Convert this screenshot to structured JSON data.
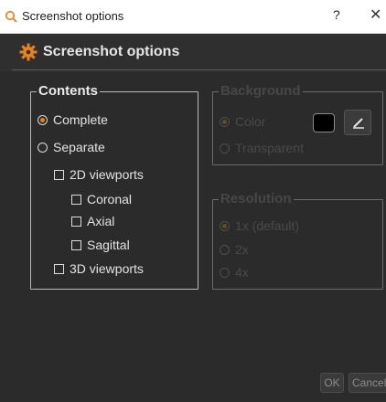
{
  "window": {
    "title": "Screenshot options",
    "help": "?",
    "close": "✕"
  },
  "header": {
    "title": "Screenshot options"
  },
  "contents": {
    "legend": "Contents",
    "options": {
      "complete": "Complete",
      "separate": "Separate",
      "viewports_2d": "2D viewports",
      "coronal": "Coronal",
      "axial": "Axial",
      "sagittal": "Sagittal",
      "viewports_3d": "3D viewports"
    },
    "selected": "Complete"
  },
  "background": {
    "legend": "Background",
    "color_label": "Color",
    "transparent_label": "Transparent",
    "selected": "Color",
    "swatch_color": "#000000"
  },
  "resolution": {
    "legend": "Resolution",
    "options": [
      "1x (default)",
      "2x",
      "4x"
    ],
    "selected": "1x (default)"
  },
  "buttons": {
    "ok": "OK",
    "cancel": "Cancel"
  },
  "colors": {
    "accent": "#e8821e",
    "background": "#2b2b2b"
  }
}
